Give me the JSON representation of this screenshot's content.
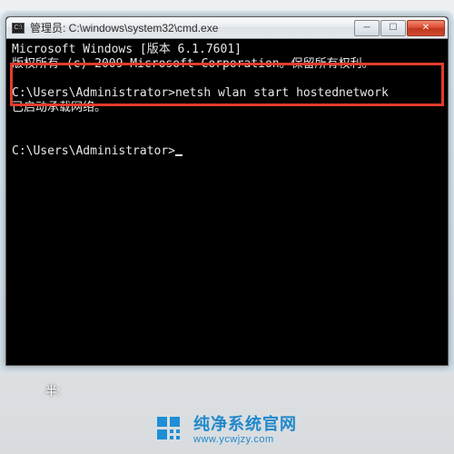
{
  "window": {
    "icon_label": "C:\\",
    "title": "管理员: C:\\windows\\system32\\cmd.exe",
    "buttons": {
      "minimize": "─",
      "maximize": "☐",
      "close": "✕"
    }
  },
  "console": {
    "line1": "Microsoft Windows [版本 6.1.7601]",
    "line2": "版权所有 (c) 2009 Microsoft Corporation。保留所有权利。",
    "blank1": "",
    "prompt1": "C:\\Users\\Administrator>netsh wlan start hostednetwork",
    "result1": "已启动承载网络。",
    "blank2": "",
    "blank3": "",
    "prompt2": "C:\\Users\\Administrator>"
  },
  "footer": {
    "label": "半:"
  },
  "watermark": {
    "cn": "纯净系统官网",
    "en": "www.ycwjzy.com"
  }
}
